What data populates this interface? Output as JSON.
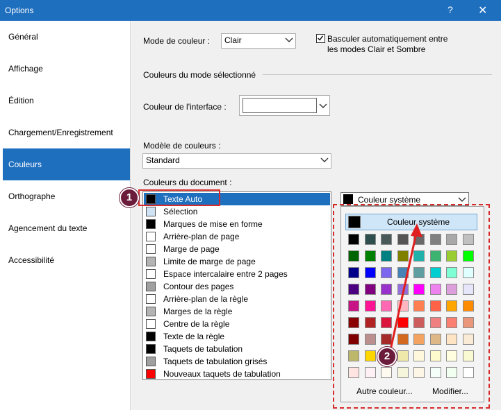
{
  "window": {
    "title": "Options",
    "help": "?",
    "close": "✕"
  },
  "nav": {
    "items": [
      {
        "label": "Général"
      },
      {
        "label": "Affichage"
      },
      {
        "label": "Édition"
      },
      {
        "label": "Chargement/Enregistrement"
      },
      {
        "label": "Couleurs",
        "active": true
      },
      {
        "label": "Orthographe"
      },
      {
        "label": "Agencement du texte"
      },
      {
        "label": "Accessibilité"
      }
    ]
  },
  "color_mode": {
    "label": "Mode de couleur :",
    "value": "Clair",
    "auto_switch_checked": true,
    "auto_switch_line1": "Basculer automatiquement entre",
    "auto_switch_line2": "les modes Clair et Sombre"
  },
  "selected_mode_section": "Couleurs du mode sélectionné",
  "interface": {
    "label": "Couleur de l'interface :",
    "value": ""
  },
  "model": {
    "label": "Modèle de couleurs :",
    "value": "Standard"
  },
  "document": {
    "label": "Couleurs du document :",
    "elements": [
      {
        "label": "Texte Auto",
        "color": "#000000",
        "selected": true
      },
      {
        "label": "Sélection",
        "color": "#cfe3f5"
      },
      {
        "label": "Marques de mise en forme",
        "color": "#000000"
      },
      {
        "label": "Arrière-plan de page",
        "color": "#ffffff"
      },
      {
        "label": "Marge de page",
        "color": "#ffffff"
      },
      {
        "label": "Limite de marge de page",
        "color": "#b4b4b4"
      },
      {
        "label": "Espace intercalaire entre 2 pages",
        "color": "#ffffff"
      },
      {
        "label": "Contour des pages",
        "color": "#a0a0a0"
      },
      {
        "label": "Arrière-plan de la règle",
        "color": "#ffffff"
      },
      {
        "label": "Marges de la règle",
        "color": "#b4b4b4"
      },
      {
        "label": "Centre de la règle",
        "color": "#ffffff"
      },
      {
        "label": "Texte de la règle",
        "color": "#000000"
      },
      {
        "label": "Taquets de tabulation",
        "color": "#000000"
      },
      {
        "label": "Taquets de tabulation grisés",
        "color": "#a0a0a0"
      },
      {
        "label": "Nouveaux taquets de tabulation",
        "color": "#ff0000"
      }
    ]
  },
  "color_picker": {
    "value": "Couleur système",
    "system_button": "Couleur système",
    "other_link": "Autre couleur...",
    "modify_link": "Modifier...",
    "grid": [
      [
        "#000000",
        "#2f4f4f",
        "#4a5a5a",
        "#555555",
        "#696969",
        "#808080",
        "#a9a9a9",
        "#c0c0c0"
      ],
      [
        "#006400",
        "#008000",
        "#008080",
        "#808000",
        "#20b2aa",
        "#3cb371",
        "#9acd32",
        "#00ff00"
      ],
      [
        "#00008b",
        "#0000ff",
        "#7b68ee",
        "#4682b4",
        "#5f9ea0",
        "#00ced1",
        "#7fffd4",
        "#e0ffff"
      ],
      [
        "#4b0082",
        "#800080",
        "#9932cc",
        "#9370db",
        "#ff00ff",
        "#ee82ee",
        "#dda0dd",
        "#e6e6fa"
      ],
      [
        "#c71585",
        "#ff1493",
        "#ff69b4",
        "#ffb6c1",
        "#ff7f50",
        "#ff6347",
        "#ffa500",
        "#ff8c00"
      ],
      [
        "#8b0000",
        "#b22222",
        "#dc143c",
        "#ff0000",
        "#cd5c5c",
        "#f08080",
        "#fa8072",
        "#e9967a"
      ],
      [
        "#800000",
        "#bc8f8f",
        "#a52a2a",
        "#d2691e",
        "#f4a460",
        "#deb887",
        "#ffe4c4",
        "#faebd7"
      ],
      [
        "#bdb76b",
        "#ffd700",
        "#f0e68c",
        "#eee8aa",
        "#fff8dc",
        "#fffacd",
        "#ffffe0",
        "#fafad2"
      ],
      [
        "#ffe4e1",
        "#fff0f5",
        "#fffaf0",
        "#f5f5dc",
        "#fdf5e6",
        "#f5fffa",
        "#f0fff0",
        "#ffffff"
      ]
    ]
  },
  "callouts": {
    "badge1": "1",
    "badge2": "2"
  },
  "colors": {
    "accent": "#1f6fbf",
    "callout": "#d62b2b",
    "badge": "#6a1c3a"
  }
}
